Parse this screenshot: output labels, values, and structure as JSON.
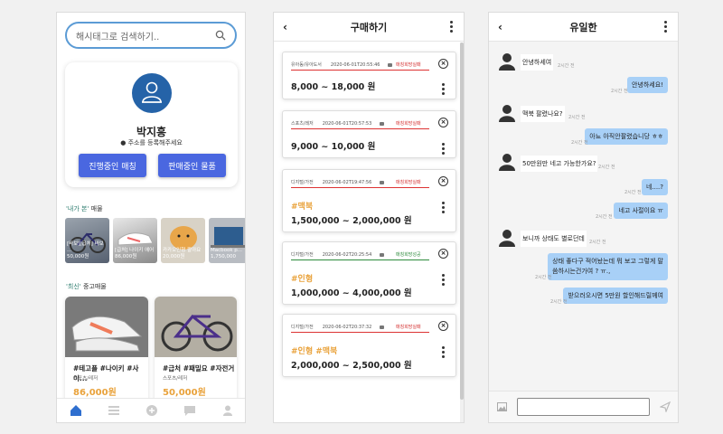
{
  "screen1": {
    "search_placeholder": "해시태그로 검색하기..",
    "profile_name": "박지흥",
    "profile_address": "주소를 등록해주세요",
    "btn_progress": "진행중인 매칭",
    "btn_selling": "판매중인 물품",
    "section1_quote": "'내가 본'",
    "section1_rest": "매물",
    "section2_quote": "'최신'",
    "section2_rest": "중고매물",
    "mini_items": [
      {
        "caption": "[바보][급처] 바보 ...",
        "price": "50,000원"
      },
      {
        "caption": "[급처] 나이키 에어",
        "price": "86,000원"
      },
      {
        "caption": "카카오인형 팔아요",
        "price": "20,000원"
      },
      {
        "caption": "Macbook p...",
        "price": "1,750,000"
      }
    ],
    "cards": [
      {
        "title": "#테고플 #나이키 #사이...",
        "category": "스포츠/레저",
        "price": "86,000원"
      },
      {
        "title": "#급처 #패밀요 #자전거",
        "category": "스포츠/레저",
        "price": "50,000원"
      }
    ],
    "tab_icons": [
      "home-icon",
      "list-icon",
      "add-icon",
      "chat-icon",
      "user-icon"
    ]
  },
  "screen2": {
    "title": "구매하기",
    "orders": [
      {
        "category": "유아동/유아도서",
        "time": "2020-06-01T20:55:46",
        "status": "매칭희망실패",
        "price": "8,000 ~ 18,000 원",
        "tags": "",
        "status_color": "#d43030"
      },
      {
        "category": "스포츠/레저",
        "time": "2020-06-01T20:57:53",
        "status": "매칭희망실패",
        "price": "9,000 ~ 10,000 원",
        "tags": "",
        "status_color": "#d43030"
      },
      {
        "category": "디지털/가전",
        "time": "2020-06-02T19:47:56",
        "status": "매칭희망실패",
        "price": "1,500,000 ~ 2,000,000 원",
        "tags": "#맥북",
        "status_color": "#d43030"
      },
      {
        "category": "디지털/가전",
        "time": "2020-06-02T20:25:54",
        "status": "매칭희망성공",
        "price": "1,000,000 ~ 4,000,000 원",
        "tags": "#인형",
        "status_color": "#2e8b3c"
      },
      {
        "category": "디지털/가전",
        "time": "2020-06-02T20:37:32",
        "status": "매칭희망실패",
        "price": "2,000,000 ~ 2,500,000 원",
        "tags": "#인형 #맥북",
        "status_color": "#d43030"
      }
    ]
  },
  "screen3": {
    "title": "유일한",
    "messages": [
      {
        "side": "in",
        "text": "안녕하세여",
        "time": "2시간 전"
      },
      {
        "side": "out",
        "text": "안녕하세요!",
        "time": "2시간 전"
      },
      {
        "side": "in",
        "text": "맥북 팔렸나요?",
        "time": "2시간 전"
      },
      {
        "side": "out",
        "text": "아뇨 아직안팔렸습니당 ㅎㅎ",
        "time": "2시간 전"
      },
      {
        "side": "in",
        "text": "50만원만 네고 가능한가요?",
        "time": "2시간 전"
      },
      {
        "side": "out",
        "text": "네....?",
        "time": "2시간 전"
      },
      {
        "side": "out",
        "text": "네고 사절이요 ㅠ",
        "time": "2시간 전"
      },
      {
        "side": "in",
        "text": "보니까 상태도 별로던데",
        "time": "2시간 전"
      },
      {
        "side": "out",
        "text": "상태 좋다구 적어놨는데 뭐 보고 그렇게 말\n씀하시는건가여 ? ㅠ.,",
        "time": "2시간 전"
      },
      {
        "side": "out",
        "text": "받으러오시면 5만원 할인해드릴께여",
        "time": "2시간 전"
      }
    ]
  }
}
